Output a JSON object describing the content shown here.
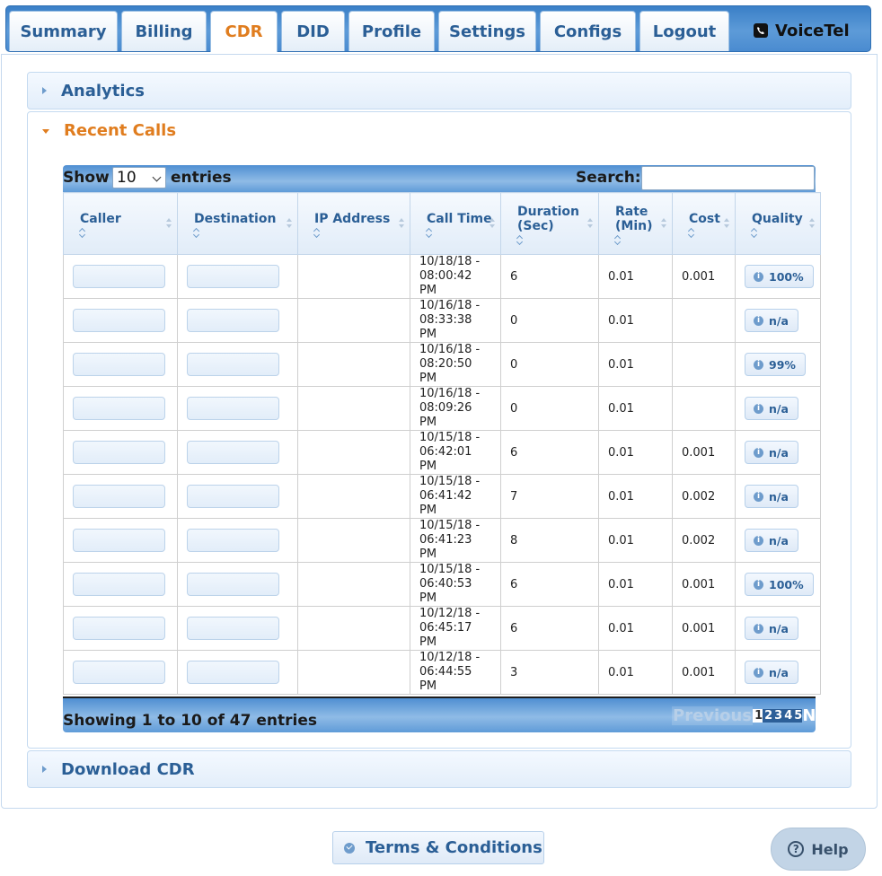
{
  "nav": {
    "tabs": [
      {
        "label": "Summary"
      },
      {
        "label": "Billing"
      },
      {
        "label": "CDR"
      },
      {
        "label": "DID"
      },
      {
        "label": "Profile"
      },
      {
        "label": "Settings"
      },
      {
        "label": "Configs"
      },
      {
        "label": "Logout"
      }
    ],
    "active_tab": "CDR",
    "brand": "VoiceTel",
    "brand_icon": "phone-icon"
  },
  "sections": {
    "analytics": "Analytics",
    "recent_calls": "Recent Calls",
    "download_cdr": "Download CDR"
  },
  "table_controls": {
    "show_label": "Show",
    "page_length": "10",
    "entries_label": "entries",
    "search_label": "Search:",
    "search_value": ""
  },
  "columns": [
    {
      "label": "Caller"
    },
    {
      "label": "Destination"
    },
    {
      "label": "IP Address"
    },
    {
      "label": "Call Time"
    },
    {
      "label": "Duration (Sec)"
    },
    {
      "label": "Rate (Min)"
    },
    {
      "label": "Cost"
    },
    {
      "label": "Quality"
    }
  ],
  "rows": [
    {
      "call_time_date": "10/18/18 -",
      "call_time_clock": "08:00:42 PM",
      "duration": "6",
      "rate": "0.01",
      "cost": "0.001",
      "quality": "100%"
    },
    {
      "call_time_date": "10/16/18 -",
      "call_time_clock": "08:33:38 PM",
      "duration": "0",
      "rate": "0.01",
      "cost": "",
      "quality": "n/a"
    },
    {
      "call_time_date": "10/16/18 -",
      "call_time_clock": "08:20:50 PM",
      "duration": "0",
      "rate": "0.01",
      "cost": "",
      "quality": "99%"
    },
    {
      "call_time_date": "10/16/18 -",
      "call_time_clock": "08:09:26 PM",
      "duration": "0",
      "rate": "0.01",
      "cost": "",
      "quality": "n/a"
    },
    {
      "call_time_date": "10/15/18 -",
      "call_time_clock": "06:42:01 PM",
      "duration": "6",
      "rate": "0.01",
      "cost": "0.001",
      "quality": "n/a"
    },
    {
      "call_time_date": "10/15/18 -",
      "call_time_clock": "06:41:42 PM",
      "duration": "7",
      "rate": "0.01",
      "cost": "0.002",
      "quality": "n/a"
    },
    {
      "call_time_date": "10/15/18 -",
      "call_time_clock": "06:41:23 PM",
      "duration": "8",
      "rate": "0.01",
      "cost": "0.002",
      "quality": "n/a"
    },
    {
      "call_time_date": "10/15/18 -",
      "call_time_clock": "06:40:53 PM",
      "duration": "6",
      "rate": "0.01",
      "cost": "0.001",
      "quality": "100%"
    },
    {
      "call_time_date": "10/12/18 -",
      "call_time_clock": "06:45:17 PM",
      "duration": "6",
      "rate": "0.01",
      "cost": "0.001",
      "quality": "n/a"
    },
    {
      "call_time_date": "10/12/18 -",
      "call_time_clock": "06:44:55 PM",
      "duration": "3",
      "rate": "0.01",
      "cost": "0.001",
      "quality": "n/a"
    }
  ],
  "pagination": {
    "info": "Showing 1 to 10 of 47 entries",
    "previous": "Previous",
    "pages": [
      "1",
      "2",
      "3",
      "4",
      "5"
    ],
    "current_page": "1",
    "next": "Next"
  },
  "footer": {
    "terms": "Terms & Conditions",
    "help": "Help"
  },
  "colors": {
    "accent": "#e07d1f",
    "primary_text": "#2b5f96",
    "header_bar": "#4a8bd0"
  }
}
